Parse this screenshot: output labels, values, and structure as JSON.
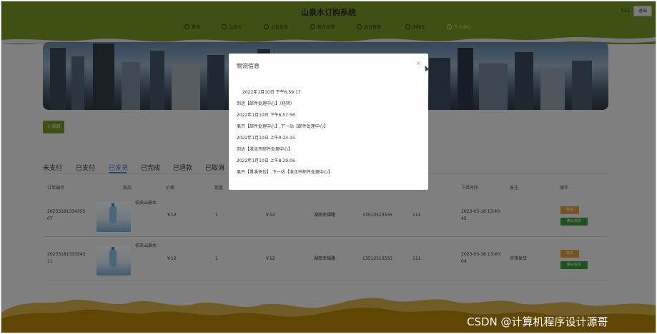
{
  "header": {
    "title": "山泉水订购系统",
    "user": "111",
    "logout_label": "退出",
    "nav": [
      {
        "label": "首页",
        "icon": "star-icon"
      },
      {
        "label": "山泉水",
        "icon": "home-icon"
      },
      {
        "label": "公告信息",
        "icon": "announcement-icon"
      },
      {
        "label": "留言反馈",
        "icon": "message-icon"
      },
      {
        "label": "后台管理",
        "icon": "admin-icon"
      },
      {
        "label": "购物车",
        "icon": "cart-icon"
      },
      {
        "label": "个人中心",
        "icon": "user-icon",
        "active": true
      }
    ]
  },
  "page": {
    "back_label": "< 返回",
    "tabs": [
      "未支付",
      "已支付",
      "已发货",
      "已完成",
      "已退款",
      "已取消"
    ],
    "active_tab": "已发货",
    "columns": [
      "订单编号",
      "商品",
      "价格",
      "数量",
      "下单时间",
      "备注",
      "操作"
    ],
    "orders": [
      {
        "id": "2023318133435507",
        "id_lines": [
          "20233181334355",
          "07"
        ],
        "product": "农夫山泉水",
        "price": "￥12",
        "quantity": "1",
        "total": "￥12",
        "address": "湖南幸福路",
        "phone": "13513513555",
        "user": "111",
        "time_lines": [
          "2023-03-18 13:40:",
          "45"
        ],
        "note": "",
        "logistics_label": "物流",
        "confirm_label": "确认收货"
      },
      {
        "id": "2023318133354311",
        "id_lines": [
          "20233181333543",
          "11"
        ],
        "product": "农夫山泉水",
        "price": "￥12",
        "quantity": "1",
        "total": "￥12",
        "address": "湖南幸福路",
        "phone": "13513513555",
        "user": "111",
        "time_lines": [
          "2023-03-18 13:40:",
          "04"
        ],
        "note": "尽快发货",
        "logistics_label": "物流",
        "confirm_label": "确认收货"
      }
    ]
  },
  "modal": {
    "title": "物流信息",
    "close_symbol": "×",
    "entries": [
      "2022年1月10日 下午6:59:17",
      "到达【邮件处理中心】（经转）",
      "2022年1月10日 下午6:57:56",
      "离开【邮件处理中心】,下一站【邮件处理中心】",
      "2022年1月10日 上午9:24:15",
      "到达【淮北市邮件处理中心】",
      "2022年1月10日 上午8:29:06",
      "离开【濉溪快包】,下一站【淮北市邮件处理中心】"
    ]
  },
  "watermark": "CSDN @计算机程序设计源哥",
  "colors": {
    "header_green": "#7a9a2a",
    "footer_gold": "#b8860b",
    "tab_active": "#4a7fd8",
    "logistics_btn": "#e0a23e",
    "confirm_btn": "#3f9a3f"
  }
}
